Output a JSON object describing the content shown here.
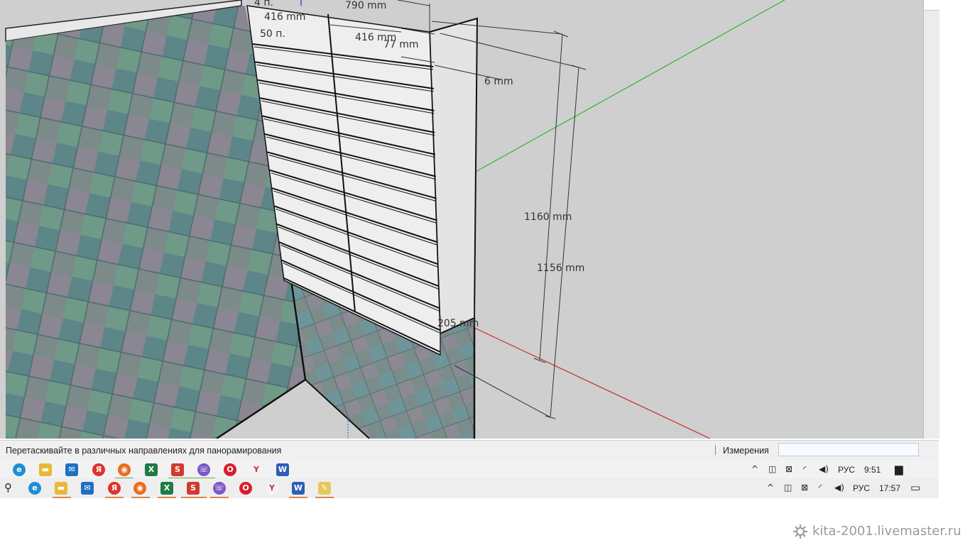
{
  "viewport": {
    "dimensions": [
      "790 mm",
      "4 п.",
      "416 mm",
      "416 mm",
      "50 п.",
      "77 mm",
      "6 mm",
      "1160 mm",
      "1156 mm",
      "205 mm"
    ]
  },
  "status_bar": {
    "hint": "Перетаскивайте в различных направлениях для панорамирования",
    "measurements_label": "Измерения",
    "measurements_value": ""
  },
  "taskbar_inner": {
    "icons": [
      "edge-icon",
      "file-explorer-icon",
      "mail-icon",
      "yandex-icon",
      "firefox-icon",
      "excel-icon",
      "sketchup-icon",
      "viber-icon",
      "opera-icon",
      "yandex-browser-icon",
      "word-icon"
    ],
    "language": "РУС",
    "time": "9:51"
  },
  "taskbar_outer": {
    "icons": [
      "search-icon",
      "edge-icon",
      "file-explorer-icon",
      "mail-icon",
      "yandex-icon",
      "firefox-icon",
      "excel-icon",
      "sketchup-icon",
      "viber-icon",
      "opera-icon",
      "yandex-browser-icon",
      "word-icon",
      "paint-icon"
    ],
    "language": "РУС",
    "time": "17:57"
  },
  "watermark": "kita-2001.livemaster.ru",
  "colors": {
    "viewport_bg": "#cfcfcf",
    "green_axis": "#2fb52f",
    "red_axis": "#cc2a2a",
    "tile_a": "#5f8a8c",
    "tile_b": "#8a8790"
  }
}
